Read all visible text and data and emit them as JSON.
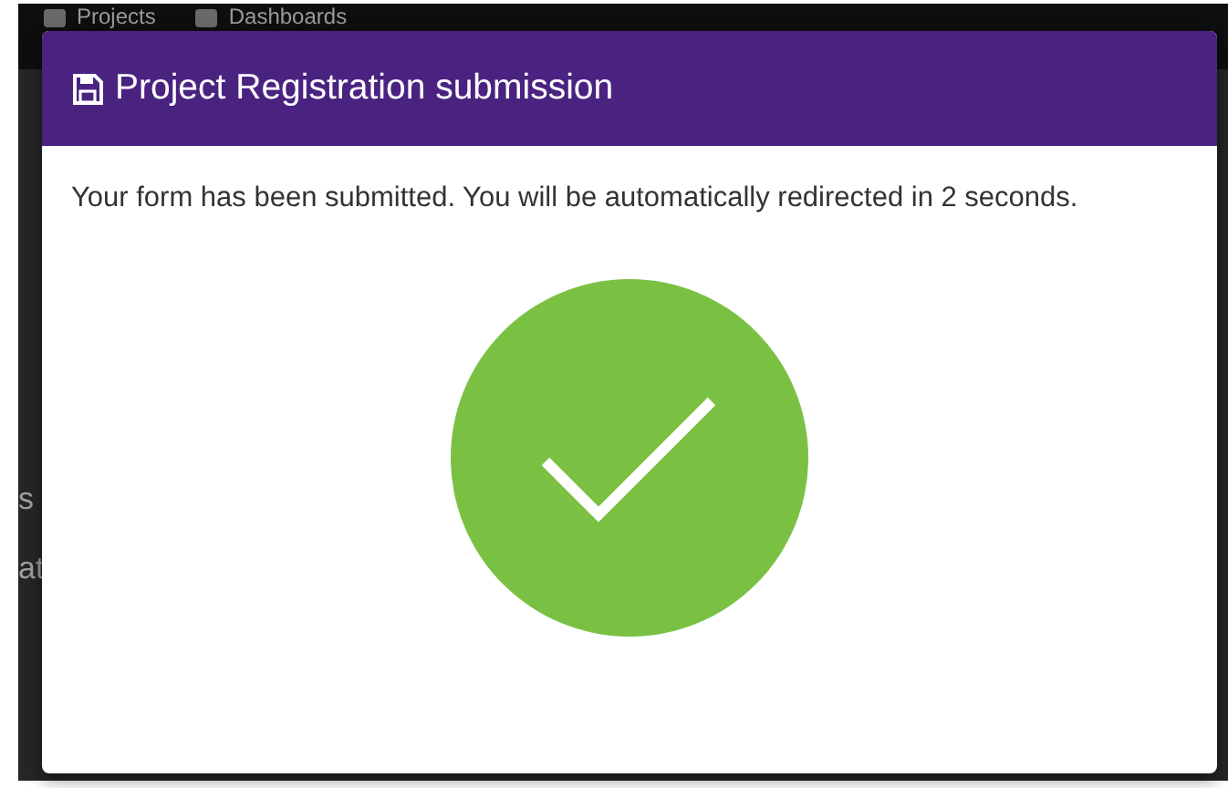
{
  "navbar": {
    "items": [
      {
        "label": "Projects"
      },
      {
        "label": "Dashboards"
      }
    ]
  },
  "background_text": [
    "s",
    "at"
  ],
  "modal": {
    "title": "Project Registration submission",
    "message": "Your form has been submitted. You will be automatically redirected in 2 seconds."
  }
}
